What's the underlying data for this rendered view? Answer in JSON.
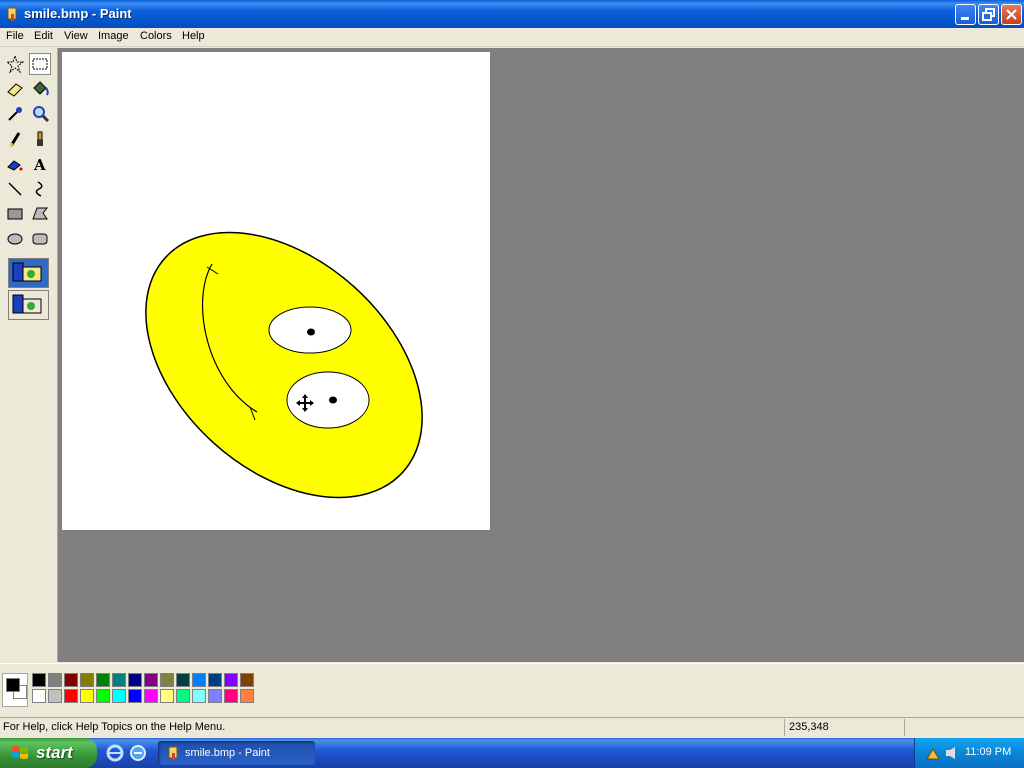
{
  "window": {
    "title": "smile.bmp - Paint"
  },
  "menu": [
    "File",
    "Edit",
    "View",
    "Image",
    "Colors",
    "Help"
  ],
  "tools": [
    "free-form-select",
    "select",
    "eraser",
    "fill-with-color",
    "pick-color",
    "magnifier",
    "pencil",
    "brush",
    "airbrush",
    "text",
    "line",
    "curve",
    "rectangle",
    "polygon",
    "ellipse",
    "rounded-rectangle"
  ],
  "selected_tool": "select",
  "colors": {
    "foreground": "#000000",
    "background": "#ffffff",
    "palette_top": [
      "#000000",
      "#808080",
      "#800000",
      "#808000",
      "#008000",
      "#008080",
      "#000080",
      "#800080",
      "#808040",
      "#004040",
      "#0080ff",
      "#004080",
      "#8000ff",
      "#804000"
    ],
    "palette_bottom": [
      "#ffffff",
      "#c0c0c0",
      "#ff0000",
      "#ffff00",
      "#00ff00",
      "#00ffff",
      "#0000ff",
      "#ff00ff",
      "#ffff80",
      "#00ff80",
      "#80ffff",
      "#8080ff",
      "#ff0080",
      "#ff8040"
    ]
  },
  "status": {
    "help": "For Help, click Help Topics on the Help Menu.",
    "coords": "235,348"
  },
  "taskbar": {
    "start": "start",
    "task": "smile.bmp - Paint",
    "clock": "11:09 PM"
  }
}
